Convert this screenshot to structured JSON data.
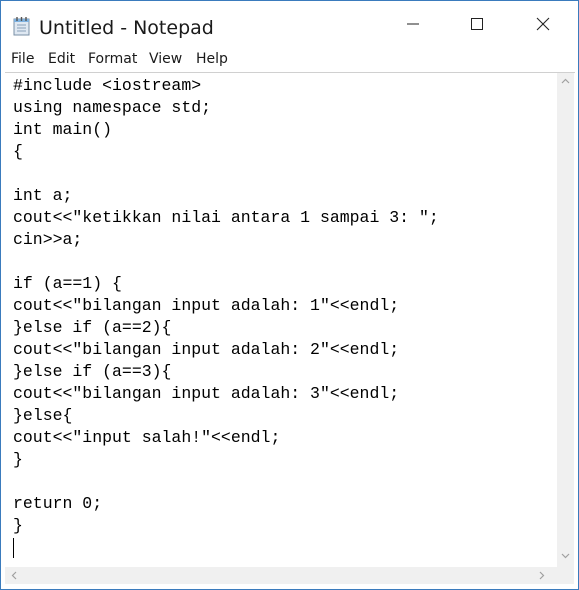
{
  "window": {
    "title": "Untitled - Notepad",
    "accent_color": "#3a7bbd"
  },
  "icons": {
    "app": "notepad-icon",
    "minimize": "minimize-icon",
    "maximize": "maximize-icon",
    "close": "close-icon"
  },
  "menu": {
    "items": [
      "File",
      "Edit",
      "Format",
      "View",
      "Help"
    ]
  },
  "editor": {
    "lines": [
      "#include <iostream>",
      "using namespace std;",
      "int main()",
      "{",
      "",
      "int a;",
      "cout<<\"ketikkan nilai antara 1 sampai 3: \";",
      "cin>>a;",
      "",
      "if (a==1) {",
      "cout<<\"bilangan input adalah: 1\"<<endl;",
      "}else if (a==2){",
      "cout<<\"bilangan input adalah: 2\"<<endl;",
      "}else if (a==3){",
      "cout<<\"bilangan input adalah: 3\"<<endl;",
      "}else{",
      "cout<<\"input salah!\"<<endl;",
      "}",
      "",
      "return 0;",
      "}",
      ""
    ]
  }
}
